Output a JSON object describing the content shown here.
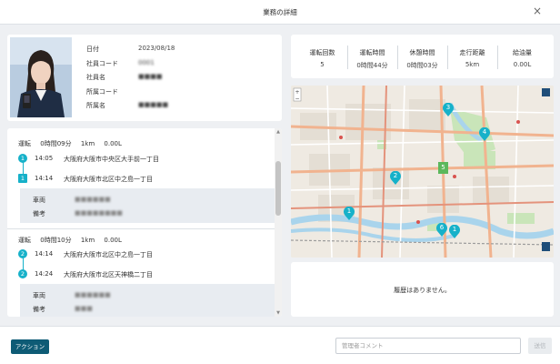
{
  "window": {
    "title": "業務の詳細",
    "close_label": "×"
  },
  "employee": {
    "rows": [
      {
        "key": "日付",
        "value": "2023/08/18",
        "blurred": false
      },
      {
        "key": "社員コード",
        "value": "0001",
        "blurred": true
      },
      {
        "key": "社員名",
        "value": "■■■■",
        "blurred": true
      },
      {
        "key": "所属コード",
        "value": "",
        "blurred": false
      },
      {
        "key": "所属名",
        "value": "■■■■■",
        "blurred": true
      }
    ]
  },
  "summary": {
    "items": [
      {
        "label": "運転回数",
        "value": "5"
      },
      {
        "label": "運転時間",
        "value": "0時間44分"
      },
      {
        "label": "休憩時間",
        "value": "0時間03分"
      },
      {
        "label": "走行距離",
        "value": "5km"
      },
      {
        "label": "給油量",
        "value": "0.00L"
      }
    ]
  },
  "trips": [
    {
      "type": "運転",
      "duration": "0時間09分",
      "distance": "1km",
      "fuel": "0.00L",
      "start": {
        "marker": "1",
        "time": "14:05",
        "address": "大阪府大阪市中央区大手前一丁目"
      },
      "end": {
        "marker": "1",
        "time": "14:14",
        "address": "大阪府大阪市北区中之島一丁目"
      },
      "vehicle_label": "車両",
      "vehicle_value": "■■■■■■",
      "note_label": "備考",
      "note_value": "■■■■■■■■"
    },
    {
      "type": "運転",
      "duration": "0時間10分",
      "distance": "1km",
      "fuel": "0.00L",
      "start": {
        "marker": "2",
        "time": "14:14",
        "address": "大阪府大阪市北区中之島一丁目"
      },
      "end": {
        "marker": "2",
        "time": "14:24",
        "address": "大阪府大阪市北区天神橋二丁目"
      },
      "vehicle_label": "車両",
      "vehicle_value": "■■■■■■",
      "note_label": "備考",
      "note_value": "■■■"
    }
  ],
  "map": {
    "markers": [
      {
        "label": "1",
        "shape": "pin",
        "color": "#16b1c9"
      },
      {
        "label": "2",
        "shape": "pin",
        "color": "#16b1c9"
      },
      {
        "label": "3",
        "shape": "pin",
        "color": "#16b1c9"
      },
      {
        "label": "4",
        "shape": "pin",
        "color": "#16b1c9"
      },
      {
        "label": "5",
        "shape": "square",
        "color": "#5cb85c"
      },
      {
        "label": "6",
        "shape": "pin",
        "color": "#16b1c9"
      },
      {
        "label": "1",
        "shape": "pin",
        "color": "#16b1c9"
      }
    ]
  },
  "history": {
    "empty_message": "履歴はありません。"
  },
  "footer": {
    "action_label": "アクション",
    "comment_placeholder": "管理者コメント",
    "send_label": "送信"
  },
  "colors": {
    "accent": "#16b1c9",
    "primary_button": "#0e5b75",
    "green_marker": "#5cb85c"
  }
}
